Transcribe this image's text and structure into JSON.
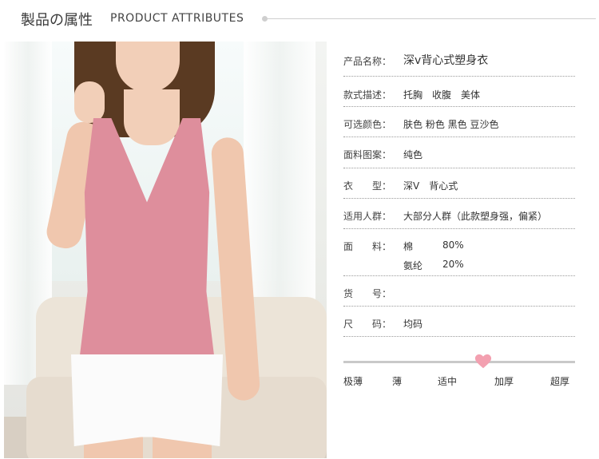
{
  "header": {
    "title_cn": "製品の属性",
    "title_en": "PRODUCT ATTRIBUTES"
  },
  "attributes": [
    {
      "label": "产品名称：",
      "value": "深v背心式塑身衣"
    },
    {
      "label": "款式描述：",
      "value": "托胸　收腹　美体"
    },
    {
      "label": "可选颜色：",
      "value": "肤色 粉色 黑色 豆沙色"
    },
    {
      "label": "面料图案：",
      "value": "纯色"
    },
    {
      "label": "衣　　型：",
      "value": "深V　背心式"
    },
    {
      "label": "适用人群：",
      "value": "大部分人群（此款塑身强，偏紧）"
    },
    {
      "label": "面　　料：",
      "fabric": [
        {
          "name": "棉",
          "percent": "80%"
        },
        {
          "name": "氨纶",
          "percent": "20%"
        }
      ]
    },
    {
      "label": "货　　号：",
      "value": ""
    },
    {
      "label": "尺　　码：",
      "value": "均码"
    }
  ],
  "thickness_scale": {
    "labels": [
      "极薄",
      "薄",
      "适中",
      "加厚",
      "超厚"
    ],
    "selected": "适中",
    "marker_color": "#f3a0b0"
  },
  "colors": {
    "top_pink": "#de8e9c",
    "text": "#333333"
  }
}
